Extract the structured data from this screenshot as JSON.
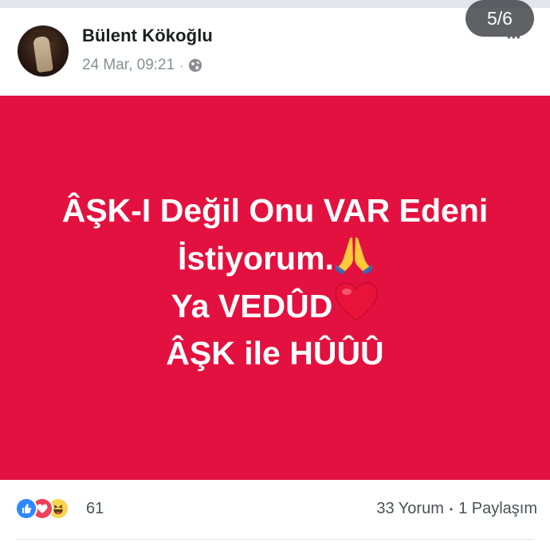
{
  "post": {
    "author": "Bülent Kökoğlu",
    "timestamp": "24 Mar, 09:21",
    "separator": "·",
    "privacy_icon": "globe-icon",
    "more_icon": "•••"
  },
  "viewer": {
    "counter": "5/6"
  },
  "image": {
    "background_color": "#e3113f",
    "text_color": "#ffffff",
    "lines": [
      "ÂŞK-I Değil Onu VAR Edeni",
      "İstiyorum.",
      "Ya VEDÛD",
      "ÂŞK ile HÛÛÛ"
    ],
    "line_emojis": [
      "",
      "folded-hands-emoji",
      "red-heart-emoji",
      ""
    ]
  },
  "reactions": {
    "icons": [
      "like-reaction-icon",
      "love-reaction-icon",
      "haha-reaction-icon"
    ],
    "count": "61",
    "comments": "33 Yorum",
    "separator": "•",
    "shares": "1 Paylaşım"
  }
}
